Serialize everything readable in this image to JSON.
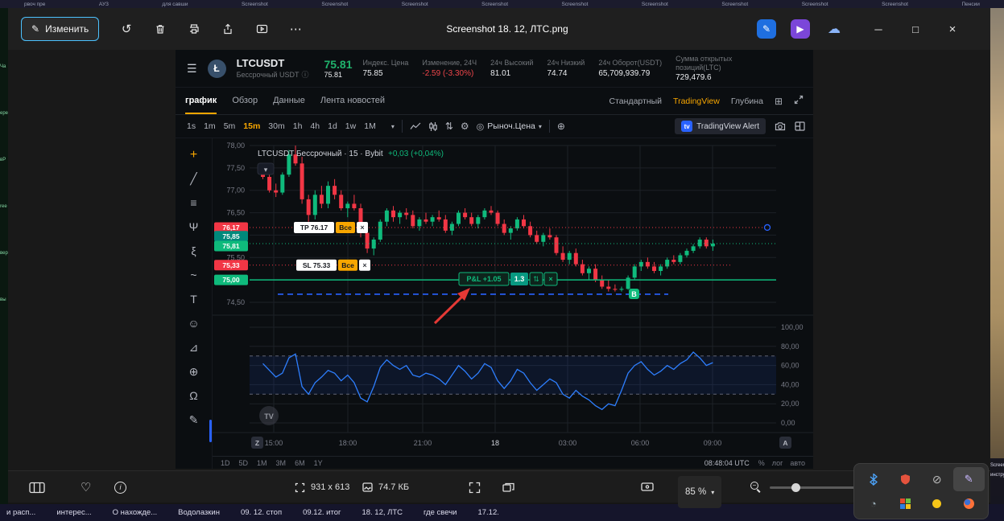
{
  "window": {
    "title": "Screenshot 18. 12, ЛТС.png",
    "edit_button": "Изменить",
    "footer": {
      "dimensions": "931 x 613",
      "filesize": "74.7 КБ",
      "zoom_level": "85 %"
    }
  },
  "background": {
    "top_tabs": [
      "рвоч пре",
      "АУЗ",
      "для савши",
      "Screenshot",
      "Screenshot",
      "Screenshot",
      "Screenshot",
      "Screenshot",
      "Screenshot",
      "Screenshot",
      "Screenshot",
      "Screenshot",
      "Пенсии"
    ],
    "bottom_tabs": [
      "и расп...",
      "интерес...",
      "О нахожде...",
      "Водолазкин",
      "09. 12. стоп",
      "09.12. итог",
      "18. 12, ЛТС",
      "где свечи",
      "17.12."
    ],
    "left_edge_fragments": [
      "Ча",
      "ере",
      "вР",
      "ree",
      "вер",
      "вы"
    ],
    "right_edge_fragments": [
      "Screensh",
      "инструкц"
    ]
  },
  "trading_ui": {
    "header": {
      "symbol": "LTCUSDT",
      "contract_type": "Бессрочный USDT",
      "last_price": "75.81",
      "mark_price": "75.81",
      "stats": [
        {
          "label": "Индекс. Цена",
          "value": "75.85",
          "color": "#eaecef"
        },
        {
          "label": "Изменение, 24Ч",
          "value": "-2.59 (-3.30%)",
          "color": "#ef454a"
        },
        {
          "label": "24ч Высокий",
          "value": "81.01",
          "color": "#eaecef"
        },
        {
          "label": "24ч Низкий",
          "value": "74.74",
          "color": "#eaecef"
        },
        {
          "label": "24ч Оборот(USDT)",
          "value": "65,709,939.79",
          "color": "#eaecef"
        },
        {
          "label": "Сумма открытых позиций(LTC)",
          "value": "729,479.6",
          "color": "#eaecef"
        }
      ]
    },
    "tabs": [
      {
        "label": "график",
        "active": true
      },
      {
        "label": "Обзор",
        "active": false
      },
      {
        "label": "Данные",
        "active": false
      },
      {
        "label": "Лента новостей",
        "active": false
      }
    ],
    "view_options": [
      {
        "label": "Стандартный",
        "active": false
      },
      {
        "label": "TradingView",
        "active": true
      },
      {
        "label": "Глубина",
        "active": false
      }
    ],
    "timeframes": [
      {
        "label": "1s"
      },
      {
        "label": "1m"
      },
      {
        "label": "5m"
      },
      {
        "label": "15m",
        "active": true
      },
      {
        "label": "30m"
      },
      {
        "label": "1h"
      },
      {
        "label": "4h"
      },
      {
        "label": "1d"
      },
      {
        "label": "1w"
      },
      {
        "label": "1M"
      }
    ],
    "order_type": "Рыноч.Цена",
    "alert_button": "TradingView Alert",
    "tv_logo": "tv",
    "drawing_tools": [
      {
        "name": "crosshair",
        "glyph": "+"
      },
      {
        "name": "trend-line",
        "glyph": "╱"
      },
      {
        "name": "channel",
        "glyph": "≡"
      },
      {
        "name": "pitchfork",
        "glyph": "Ψ"
      },
      {
        "name": "fibonacci",
        "glyph": "ξ"
      },
      {
        "name": "brush",
        "glyph": "~"
      },
      {
        "name": "text",
        "glyph": "T"
      },
      {
        "name": "emoji",
        "glyph": "☺"
      },
      {
        "name": "ruler",
        "glyph": "⊿"
      },
      {
        "name": "zoom-in",
        "glyph": "⊕"
      },
      {
        "name": "magnet",
        "glyph": "Ω"
      },
      {
        "name": "pencil",
        "glyph": "✎"
      }
    ],
    "bottom_bar": {
      "ranges": [
        "1D",
        "5D",
        "1M",
        "3M",
        "6M",
        "1Y"
      ],
      "clock": "08:48:04 UTC",
      "scale_modes": [
        "%",
        "лог",
        "авто"
      ]
    }
  },
  "chart_data": {
    "type": "candlestick",
    "legend": "LTCUSDT Бессрочный · 15 · Bybit",
    "legend_change": "+0,03 (+0,04%)",
    "price_range": [
      74.5,
      78.0
    ],
    "price_gridlines": [
      78.0,
      77.5,
      77.0,
      76.5,
      76.0,
      75.5,
      75.0,
      74.5
    ],
    "price_labels": [
      "78,00",
      "77,50",
      "77,00",
      "76,50",
      "76,00",
      "75,50",
      "75,00",
      "74,50"
    ],
    "time_labels": [
      "15:00",
      "18:00",
      "21:00",
      "18",
      "03:00",
      "06:00",
      "09:00"
    ],
    "candles": [
      [
        77.45,
        77.6,
        77.25,
        77.3
      ],
      [
        77.3,
        77.4,
        76.95,
        77.0
      ],
      [
        77.0,
        77.15,
        76.85,
        76.95
      ],
      [
        76.95,
        77.4,
        76.9,
        77.35
      ],
      [
        77.35,
        77.9,
        77.3,
        77.8
      ],
      [
        77.8,
        78.0,
        77.55,
        77.6
      ],
      [
        77.6,
        77.75,
        76.7,
        76.8
      ],
      [
        76.8,
        76.9,
        76.3,
        76.45
      ],
      [
        76.45,
        77.0,
        76.35,
        76.9
      ],
      [
        76.9,
        77.1,
        76.6,
        76.7
      ],
      [
        76.7,
        77.2,
        76.6,
        77.1
      ],
      [
        77.1,
        77.25,
        76.8,
        76.9
      ],
      [
        76.9,
        77.0,
        76.55,
        76.6
      ],
      [
        76.6,
        76.75,
        76.4,
        76.7
      ],
      [
        76.7,
        76.9,
        76.55,
        76.6
      ],
      [
        76.6,
        76.7,
        75.95,
        76.05
      ],
      [
        76.05,
        76.15,
        75.6,
        75.7
      ],
      [
        75.7,
        75.95,
        75.55,
        75.9
      ],
      [
        75.9,
        76.35,
        75.85,
        76.3
      ],
      [
        76.3,
        76.6,
        76.2,
        76.55
      ],
      [
        76.55,
        76.65,
        76.3,
        76.4
      ],
      [
        76.4,
        76.55,
        76.25,
        76.5
      ],
      [
        76.5,
        76.6,
        76.35,
        76.45
      ],
      [
        76.45,
        76.55,
        76.15,
        76.2
      ],
      [
        76.2,
        76.4,
        76.1,
        76.35
      ],
      [
        76.35,
        76.5,
        76.25,
        76.3
      ],
      [
        76.3,
        76.45,
        76.2,
        76.4
      ],
      [
        76.4,
        76.55,
        76.3,
        76.35
      ],
      [
        76.35,
        76.45,
        76.05,
        76.1
      ],
      [
        76.1,
        76.3,
        76.0,
        76.25
      ],
      [
        76.25,
        76.55,
        76.2,
        76.5
      ],
      [
        76.5,
        76.6,
        76.35,
        76.4
      ],
      [
        76.4,
        76.5,
        76.2,
        76.25
      ],
      [
        76.25,
        76.45,
        76.15,
        76.4
      ],
      [
        76.4,
        76.6,
        76.35,
        76.55
      ],
      [
        76.55,
        76.65,
        76.45,
        76.5
      ],
      [
        76.5,
        76.55,
        76.2,
        76.25
      ],
      [
        76.25,
        76.35,
        76.0,
        76.05
      ],
      [
        76.05,
        76.2,
        75.9,
        76.15
      ],
      [
        76.15,
        76.4,
        76.1,
        76.35
      ],
      [
        76.35,
        76.45,
        76.15,
        76.2
      ],
      [
        76.2,
        76.3,
        75.95,
        76.0
      ],
      [
        76.0,
        76.1,
        75.8,
        75.85
      ],
      [
        75.85,
        76.05,
        75.75,
        76.0
      ],
      [
        76.0,
        76.15,
        75.9,
        75.95
      ],
      [
        75.95,
        76.0,
        75.55,
        75.6
      ],
      [
        75.6,
        75.75,
        75.4,
        75.45
      ],
      [
        75.45,
        75.65,
        75.35,
        75.6
      ],
      [
        75.6,
        75.7,
        75.3,
        75.35
      ],
      [
        75.35,
        75.45,
        75.1,
        75.15
      ],
      [
        75.15,
        75.3,
        75.0,
        75.25
      ],
      [
        75.25,
        75.35,
        74.95,
        75.0
      ],
      [
        75.0,
        75.1,
        74.8,
        74.85
      ],
      [
        74.85,
        75.0,
        74.74,
        74.8
      ],
      [
        74.8,
        74.9,
        74.74,
        74.78
      ],
      [
        74.78,
        74.85,
        74.74,
        74.8
      ],
      [
        74.8,
        75.1,
        74.78,
        75.05
      ],
      [
        75.05,
        75.35,
        75.0,
        75.3
      ],
      [
        75.3,
        75.45,
        75.2,
        75.4
      ],
      [
        75.4,
        75.5,
        75.25,
        75.3
      ],
      [
        75.3,
        75.4,
        75.15,
        75.2
      ],
      [
        75.2,
        75.35,
        75.1,
        75.3
      ],
      [
        75.3,
        75.5,
        75.25,
        75.45
      ],
      [
        75.45,
        75.55,
        75.35,
        75.4
      ],
      [
        75.4,
        75.6,
        75.35,
        75.55
      ],
      [
        75.55,
        75.7,
        75.5,
        75.65
      ],
      [
        75.65,
        75.8,
        75.6,
        75.75
      ],
      [
        75.75,
        75.95,
        75.7,
        75.9
      ],
      [
        75.9,
        75.95,
        75.7,
        75.75
      ],
      [
        75.75,
        75.9,
        75.65,
        75.81
      ]
    ],
    "oscillator": {
      "type": "rsi",
      "levels": [
        100,
        80,
        60,
        40,
        20,
        0
      ],
      "level_labels": [
        "100,00",
        "80,00",
        "60,00",
        "40,00",
        "20,00",
        "0,00"
      ],
      "band": [
        30,
        70
      ],
      "values": [
        62,
        55,
        48,
        52,
        68,
        72,
        38,
        30,
        42,
        48,
        55,
        52,
        44,
        50,
        42,
        26,
        22,
        38,
        58,
        66,
        60,
        56,
        60,
        50,
        48,
        52,
        50,
        46,
        40,
        50,
        60,
        54,
        46,
        52,
        62,
        58,
        44,
        36,
        44,
        56,
        52,
        42,
        34,
        40,
        46,
        42,
        30,
        26,
        34,
        28,
        24,
        18,
        14,
        20,
        18,
        34,
        52,
        60,
        64,
        56,
        50,
        54,
        60,
        56,
        62,
        66,
        74,
        68,
        60,
        63
      ]
    },
    "order_lines": {
      "tp": {
        "price": 76.17,
        "tag": "76,17",
        "label": "TP 76.17",
        "button": "Все",
        "color": "#f23645"
      },
      "sl": {
        "price": 75.33,
        "tag": "75,33",
        "label": "SL 75.33",
        "button": "Все",
        "color": "#f23645"
      },
      "entry": {
        "price": 75.0,
        "tag": "75,00",
        "color": "#0fba7c"
      },
      "last": {
        "price": 75.81,
        "tag": "75,81",
        "color": "#0fba7c"
      },
      "index": {
        "price": 75.85,
        "tag": "75,85",
        "color": "#00897b"
      },
      "liquidation": {
        "price": 74.68,
        "color": "#2962ff"
      }
    },
    "pnl_label": {
      "text": "P&L +1.05",
      "leverage": "1.3"
    },
    "buy_marker": "B",
    "zoom_button": "Z",
    "auto_button": "A",
    "watermark": "TV",
    "colors": {
      "up": "#0fba7c",
      "down": "#f23645",
      "rsi": "#2e7fff",
      "grid": "#1c2127",
      "axis_text": "#787b86"
    }
  }
}
